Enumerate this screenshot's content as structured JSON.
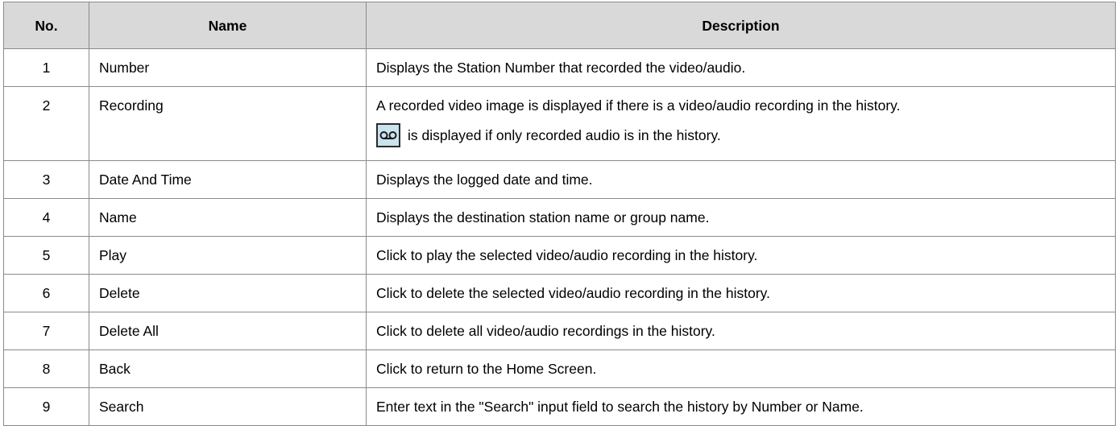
{
  "table": {
    "headers": {
      "no": "No.",
      "name": "Name",
      "description": "Description"
    },
    "rows": [
      {
        "no": "1",
        "name": "Number",
        "description": "Displays the Station Number that recorded the video/audio."
      },
      {
        "no": "2",
        "name": "Recording",
        "description": "A recorded video image is displayed if there is a video/audio recording in the history.",
        "description_extra": "is displayed if only recorded audio is in the history.",
        "icon": "voice-recording-icon"
      },
      {
        "no": "3",
        "name": "Date And Time",
        "description": "Displays the logged date and time."
      },
      {
        "no": "4",
        "name": "Name",
        "description": "Displays the destination station name or group name."
      },
      {
        "no": "5",
        "name": "Play",
        "description": "Click to play the selected video/audio recording in the history."
      },
      {
        "no": "6",
        "name": "Delete",
        "description": "Click to delete the selected video/audio recording in the history."
      },
      {
        "no": "7",
        "name": "Delete All",
        "description": "Click to delete all video/audio recordings in the history."
      },
      {
        "no": "8",
        "name": "Back",
        "description": "Click to return to the Home Screen."
      },
      {
        "no": "9",
        "name": "Search",
        "description": "Enter text in the \"Search\" input field to search the history by Number or Name."
      }
    ]
  },
  "colors": {
    "header_bg": "#d9d9d9",
    "border": "#8a8a8a",
    "icon_bg": "#c9e3ef"
  }
}
